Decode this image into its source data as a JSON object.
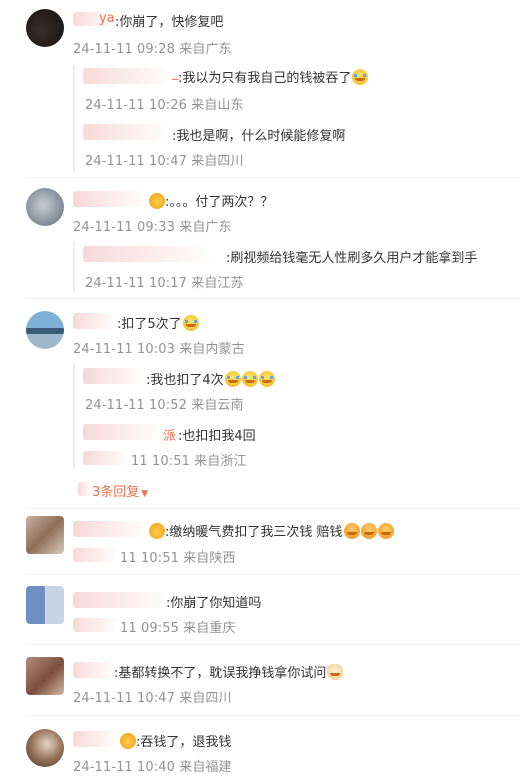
{
  "comments": [
    {
      "name_tail": "ya",
      "text": ":你崩了，快修复吧",
      "time": "24-11-11 09:28 来自广东",
      "replies": [
        {
          "name_tail": "_",
          "text": ":我以为只有我自己的钱被吞了",
          "emoji": [
            "cry"
          ],
          "time": "24-11-11 10:26 来自山东"
        },
        {
          "name_tail": "",
          "text": ":我也是啊，什么时候能修复啊",
          "emoji": [],
          "time": "24-11-11 10:47 来自四川"
        }
      ]
    },
    {
      "name_tail": "",
      "text": ":。。。付了两次？？",
      "time": "24-11-11 09:33 来自广东",
      "replies": [
        {
          "name_tail": "",
          "text": ":刷视频给钱毫无人性刷多久用户才能拿到手",
          "emoji": [],
          "time": "24-11-11 10:17 来自江苏"
        }
      ]
    },
    {
      "name_tail": "",
      "text": ":扣了5次了",
      "time": "24-11-11 10:03 来自内蒙古",
      "replies": [
        {
          "name_tail": "",
          "text": ":我也扣了4次",
          "emoji": [
            "cry",
            "cry",
            "cry"
          ],
          "time": "24-11-11 10:52 来自云南"
        },
        {
          "name_tail": "派",
          "text": ":也扣扣我4回",
          "emoji": [],
          "time": "11 10:51 来自浙江"
        }
      ],
      "more": "3条回复"
    },
    {
      "name_tail": "",
      "text": ":缴纳暖气费扣了我三次钱  赔钱",
      "time": "11 10:51 来自陕西",
      "replies": []
    },
    {
      "name_tail": "",
      "text": ":你崩了你知道吗",
      "time": "11 09:55 来自重庆",
      "replies": []
    },
    {
      "name_tail": "",
      "text": ":基都转换不了，耽误我挣钱拿你试问",
      "time": "24-11-11 10:47 来自四川",
      "replies": []
    },
    {
      "name_tail": "",
      "text": ":吞钱了，退我钱",
      "time": "24-11-11 10:40 来自福建",
      "replies": []
    }
  ]
}
